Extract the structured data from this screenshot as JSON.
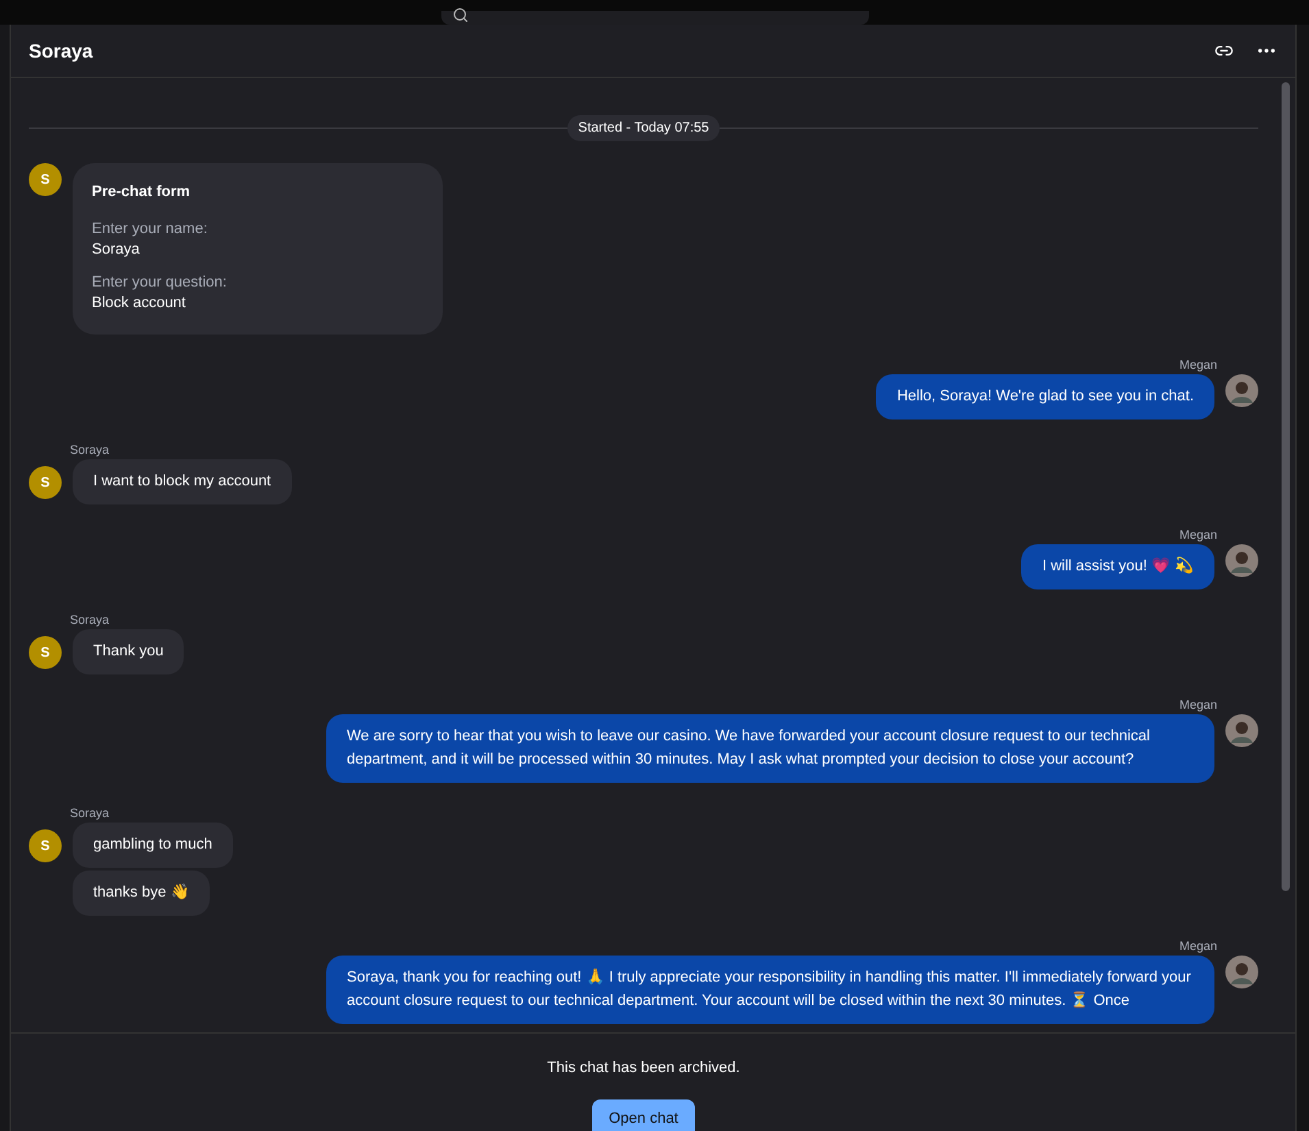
{
  "header": {
    "title": "Soraya"
  },
  "divider": {
    "label": "Started - Today 07:55"
  },
  "messages": [
    {
      "kind": "form",
      "initial": "S",
      "title": "Pre-chat form",
      "fields": [
        {
          "label": "Enter your name:",
          "value": "Soraya"
        },
        {
          "label": "Enter your question:",
          "value": "Block account"
        }
      ]
    },
    {
      "kind": "agent",
      "author": "Megan",
      "texts": [
        "Hello, Soraya! We're glad to see you in chat."
      ]
    },
    {
      "kind": "visitor",
      "author": "Soraya",
      "initial": "S",
      "texts": [
        "I want to block my account"
      ]
    },
    {
      "kind": "agent",
      "author": "Megan",
      "texts": [
        "I will assist you! 💗 💫"
      ]
    },
    {
      "kind": "visitor",
      "author": "Soraya",
      "initial": "S",
      "texts": [
        "Thank you"
      ]
    },
    {
      "kind": "agent",
      "author": "Megan",
      "texts": [
        "We are sorry to hear that you wish to leave our casino. We have forwarded your account closure request to our technical department, and it will be processed within 30 minutes. May I ask what prompted your decision to close your account?"
      ]
    },
    {
      "kind": "visitor",
      "author": "Soraya",
      "initial": "S",
      "texts": [
        "gambling to much",
        "thanks bye 👋"
      ]
    },
    {
      "kind": "agent",
      "author": "Megan",
      "texts": [
        "Soraya, thank you for reaching out! 🙏 I truly appreciate your responsibility in handling this matter. I'll immediately forward your account closure request to our technical department. Your account will be closed within the next 30 minutes. ⏳ Once"
      ]
    }
  ],
  "footer": {
    "notice": "This chat has been archived.",
    "button": "Open chat"
  }
}
